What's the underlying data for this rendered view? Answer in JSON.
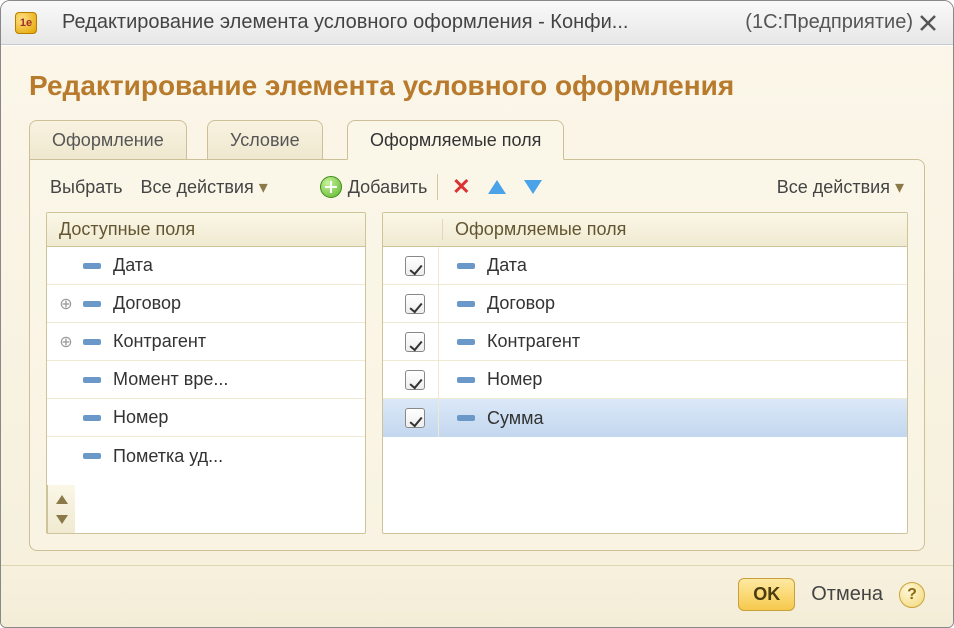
{
  "window": {
    "title": "Редактирование элемента условного оформления - Конфи...",
    "suffix": "(1С:Предприятие)"
  },
  "heading": "Редактирование элемента условного оформления",
  "tabs": {
    "t1": "Оформление",
    "t2": "Условие",
    "t3": "Оформляемые поля"
  },
  "toolbar": {
    "select": "Выбрать",
    "all_actions": "Все действия",
    "add": "Добавить",
    "all_actions_right": "Все действия"
  },
  "left_panel": {
    "header": "Доступные поля",
    "items": [
      {
        "label": "Дата",
        "expandable": false
      },
      {
        "label": "Договор",
        "expandable": true
      },
      {
        "label": "Контрагент",
        "expandable": true
      },
      {
        "label": "Момент вре...",
        "expandable": false
      },
      {
        "label": "Номер",
        "expandable": false
      },
      {
        "label": "Пометка уд...",
        "expandable": false
      }
    ]
  },
  "right_panel": {
    "header": "Оформляемые поля",
    "items": [
      {
        "label": "Дата",
        "checked": true,
        "selected": false
      },
      {
        "label": "Договор",
        "checked": true,
        "selected": false
      },
      {
        "label": "Контрагент",
        "checked": true,
        "selected": false
      },
      {
        "label": "Номер",
        "checked": true,
        "selected": false
      },
      {
        "label": "Сумма",
        "checked": true,
        "selected": true
      }
    ]
  },
  "footer": {
    "ok": "OK",
    "cancel": "Отмена"
  }
}
